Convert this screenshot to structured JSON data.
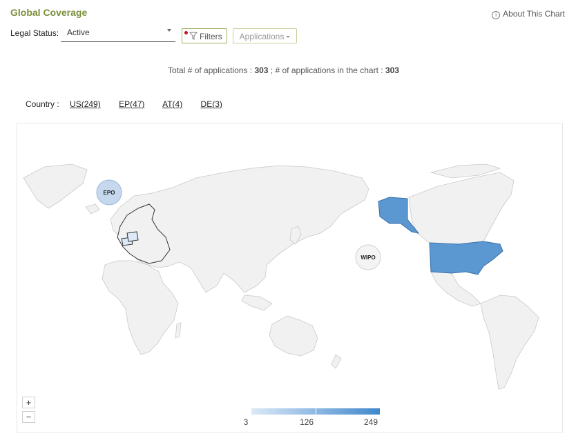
{
  "header": {
    "title": "Global Coverage",
    "about_label": "About This Chart",
    "about_icon": "info-icon"
  },
  "controls": {
    "legal_status_label": "Legal Status:",
    "legal_status_value": "Active",
    "filters_label": "Filters",
    "applications_label": "Applications"
  },
  "summary": {
    "total_label": "Total # of applications :",
    "total_value": "303",
    "separator": ";",
    "in_chart_label": "# of applications in the chart :",
    "in_chart_value": "303"
  },
  "country_filter": {
    "label": "Country :",
    "links": [
      "US(249)",
      "EP(47)",
      "AT(4)",
      "DE(3)"
    ]
  },
  "chart_data": {
    "type": "map",
    "regions": [
      {
        "code": "US",
        "count": 249
      },
      {
        "code": "EP",
        "count": 47
      },
      {
        "code": "AT",
        "count": 4
      },
      {
        "code": "DE",
        "count": 3
      }
    ],
    "bubbles": [
      {
        "label": "EPO"
      },
      {
        "label": "WIPO"
      }
    ],
    "color_scale": {
      "min": 3,
      "mid": 126,
      "max": 249,
      "low_color": "#dce9f7",
      "high_color": "#3f87cc"
    },
    "colors": {
      "land": "#f1f1f1",
      "land_stroke": "#c9c9c9",
      "highlight": "#5b97d1",
      "epo_bubble": "#c5d8ee"
    }
  },
  "zoom": {
    "in_label": "+",
    "out_label": "−"
  }
}
